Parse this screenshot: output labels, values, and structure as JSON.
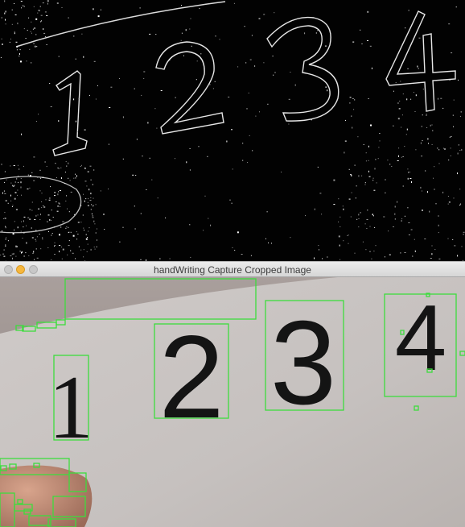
{
  "window": {
    "title": "handWriting Capture Cropped Image",
    "controls": [
      "close",
      "minimize",
      "zoom"
    ]
  },
  "edge_view": {
    "digits": [
      "1",
      "2",
      "3",
      "4"
    ]
  },
  "capture_view": {
    "digits": [
      "1",
      "2",
      "3",
      "4"
    ],
    "box_color": "#3ddc3d"
  },
  "colors": {
    "edge_background": "#020202",
    "edge_stroke": "#e8e8e8",
    "paper": "#c9c4c2",
    "ink": "#161616",
    "minimize_light": "#f6b73d"
  }
}
